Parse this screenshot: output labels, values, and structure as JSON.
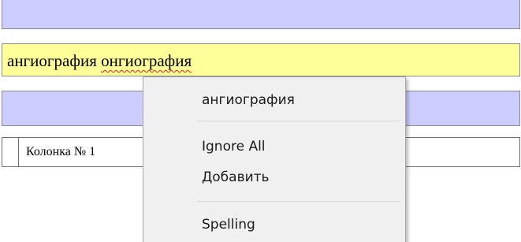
{
  "editor": {
    "text_correct": "ангиография",
    "text_misspelled": "онгиография"
  },
  "table": {
    "column_header": "Колонка № 1"
  },
  "context_menu": {
    "suggestion": "ангиография",
    "ignore_all": "Ignore All",
    "add": "Добавить",
    "spelling": "Spelling"
  },
  "colors": {
    "band_background": "#ccccff",
    "field_background": "#ffff99",
    "spell_underline": "#e02020",
    "menu_background": "#f0f0f0"
  }
}
